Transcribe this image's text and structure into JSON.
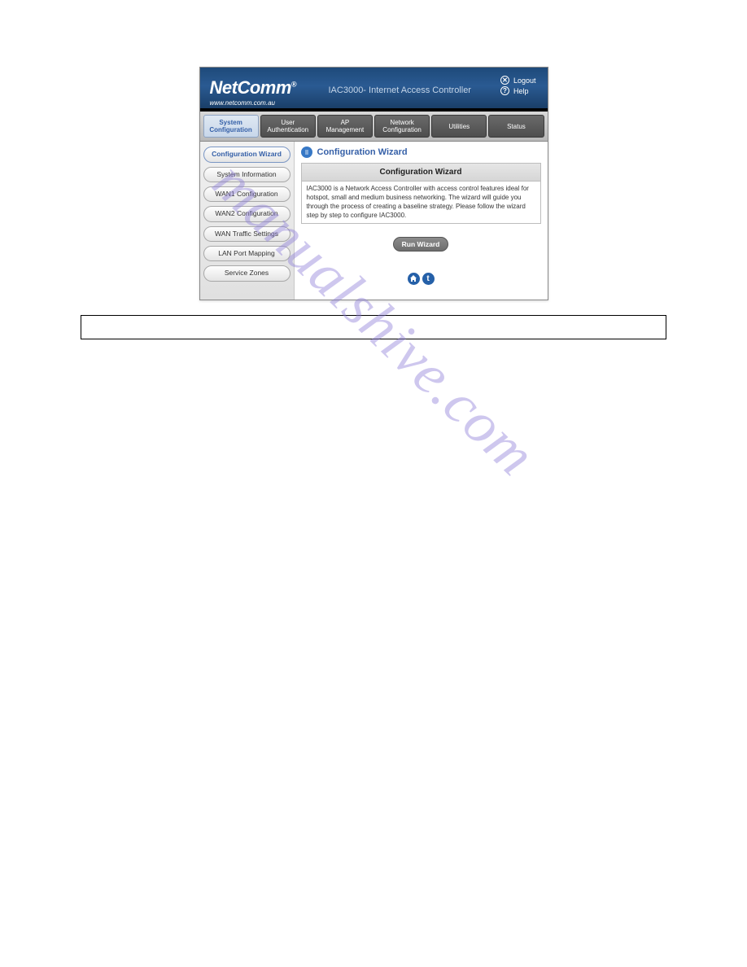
{
  "header": {
    "brand": "NetComm",
    "trademark": "®",
    "product": "IAC3000- Internet Access Controller",
    "url": "www.netcomm.com.au",
    "links": {
      "logout": "Logout",
      "help": "Help"
    }
  },
  "nav": {
    "items": [
      {
        "label": "System\nConfiguration",
        "active": true
      },
      {
        "label": "User\nAuthentication",
        "active": false
      },
      {
        "label": "AP\nManagement",
        "active": false
      },
      {
        "label": "Network\nConfiguration",
        "active": false
      },
      {
        "label": "Utilities",
        "active": false
      },
      {
        "label": "Status",
        "active": false
      }
    ]
  },
  "sidebar": {
    "items": [
      {
        "label": "Configuration Wizard",
        "active": true
      },
      {
        "label": "System Information",
        "active": false
      },
      {
        "label": "WAN1 Configuration",
        "active": false
      },
      {
        "label": "WAN2 Configuration",
        "active": false
      },
      {
        "label": "WAN Traffic Settings",
        "active": false
      },
      {
        "label": "LAN Port Mapping",
        "active": false
      },
      {
        "label": "Service Zones",
        "active": false
      }
    ]
  },
  "content": {
    "page_title": "Configuration Wizard",
    "panel_title": "Configuration Wizard",
    "description": "IAC3000 is a Network Access Controller with access control features ideal for hotspot, small and medium business networking. The wizard will guide you through the process of creating a baseline strategy. Please follow the wizard step by step to configure IAC3000.",
    "run_button": "Run Wizard",
    "icon_home": "⌂",
    "icon_up": "t"
  },
  "watermark": "manualshive.com"
}
